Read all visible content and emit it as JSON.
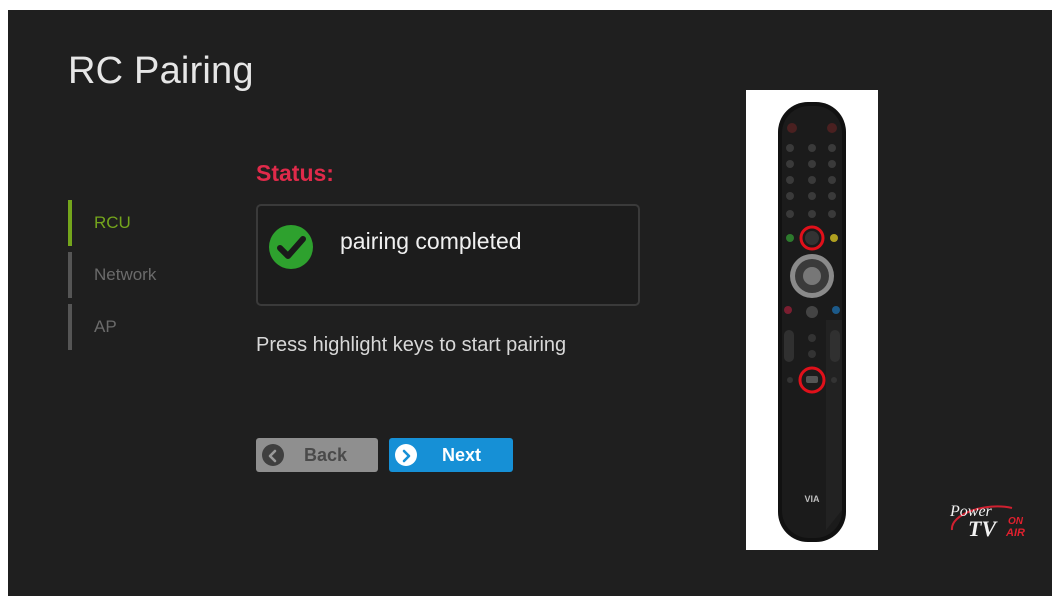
{
  "page": {
    "title": "RC Pairing"
  },
  "steps": [
    {
      "label": "RCU",
      "active": true
    },
    {
      "label": "Network",
      "active": false
    },
    {
      "label": "AP",
      "active": false
    }
  ],
  "status": {
    "label": "Status:",
    "message": "pairing completed",
    "icon": "check-circle-icon"
  },
  "instruction": "Press highlight keys to start pairing",
  "buttons": {
    "back": "Back",
    "next": "Next"
  },
  "remote": {
    "brand": "VIA",
    "highlight_color": "#e0101a"
  },
  "logo": {
    "line1": "Power",
    "line2": "TV",
    "on": "ON",
    "air": "AIR"
  },
  "colors": {
    "background": "#1f1f1f",
    "accent_green": "#74a51c",
    "status_red": "#e02a4a",
    "next_blue": "#1690d6",
    "check_green": "#2ea12e"
  }
}
